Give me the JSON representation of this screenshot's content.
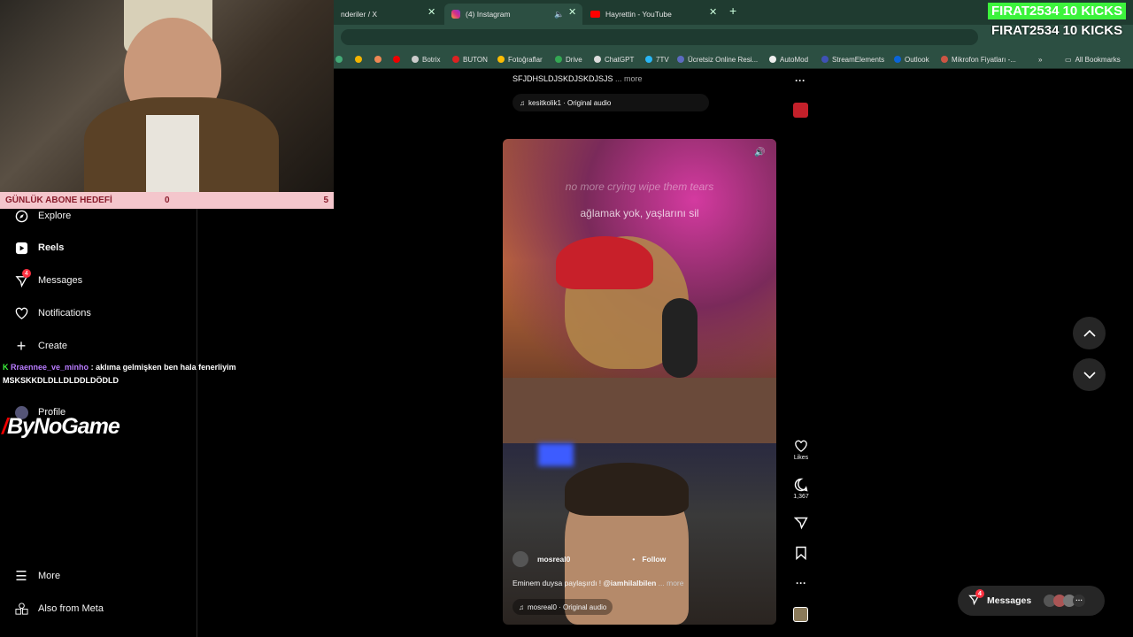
{
  "browser": {
    "tabs": [
      {
        "label": "nderiler / X"
      },
      {
        "label": "(4) Instagram"
      },
      {
        "label": "Hayrettin - YouTube"
      }
    ],
    "new_tab": "+",
    "bookmarks": [
      "Botrix",
      "BUTON",
      "Fotoğraflar",
      "Drive",
      "ChatGPT",
      "7TV",
      "Ücretsiz Online Resi...",
      "AutoMod",
      "StreamElements",
      "Outlook",
      "Mikrofon Fiyatları -..."
    ],
    "all_bookmarks": "All Bookmarks"
  },
  "stream": {
    "kick_green": "FIRAT2534  10 KICKS",
    "kick_white": "FIRAT2534  10 KICKS",
    "goal_label": "GÜNLÜK ABONE HEDEFİ",
    "goal_current": "0",
    "goal_target": "5",
    "chat_user": "Rraennee_ve_minho",
    "chat_msg": ": aklıma gelmişken ben hala fenerliyim",
    "chat_line2": "MSKSKKDLDLLDLDDLDÖDLD",
    "brand": "ByNoGame"
  },
  "sidebar": {
    "items": [
      {
        "label": "Explore"
      },
      {
        "label": "Reels"
      },
      {
        "label": "Messages",
        "badge": "4"
      },
      {
        "label": "Notifications"
      },
      {
        "label": "Create"
      },
      {
        "label": "Profile"
      }
    ],
    "more": "More",
    "meta": "Also from Meta"
  },
  "prev_post": {
    "caption": "SFJDHSLDJSKDJSKDJSJS",
    "more": "... more",
    "audio": "kesitkolik1 · Original audio"
  },
  "reel": {
    "lyric1": "no more crying wipe them tears",
    "lyric2": "ağlamak yok, yaşlarını sil",
    "username": "mosreal0",
    "follow": "Follow",
    "caption_pre": "Eminem duysa paylaşırdı ! ",
    "caption_mention": "@iamhilalbilen",
    "more": "... more",
    "audio": "mosreal0 · Original audio",
    "likes": "Likes",
    "comments": "1,367"
  },
  "messages_pill": {
    "label": "Messages",
    "badge": "4"
  },
  "colors": {
    "kick_green": "#3cf33c",
    "goal_bg": "#f4c6cc",
    "tab_bg": "#1f3b30",
    "toolbar_bg": "#2c4f42",
    "badge": "#ff3040"
  }
}
